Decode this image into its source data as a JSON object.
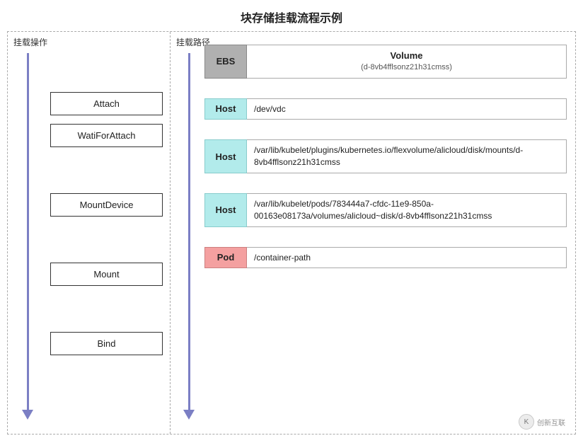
{
  "title": "块存储挂载流程示例",
  "left_header": "挂载操作",
  "right_header": "挂载路径",
  "operations": [
    {
      "id": "attach",
      "label": "Attach",
      "class": "op-attach"
    },
    {
      "id": "waitforattach",
      "label": "WatiForAttach",
      "class": "op-waitfor"
    },
    {
      "id": "mountdevice",
      "label": "MountDevice",
      "class": "op-mountdevice"
    },
    {
      "id": "mount",
      "label": "Mount",
      "class": "op-mount"
    },
    {
      "id": "bind",
      "label": "Bind",
      "class": "op-bind"
    }
  ],
  "paths": [
    {
      "id": "ebs-volume",
      "label_type": "ebs",
      "label": "EBS",
      "value_title": "Volume",
      "value_sub": "(d-8vb4fflsonz21h31cmss)",
      "type": "ebs"
    },
    {
      "id": "host-dev",
      "label_type": "host",
      "label": "Host",
      "value": "/dev/vdc",
      "type": "host-simple"
    },
    {
      "id": "host-kubelet",
      "label_type": "host",
      "label": "Host",
      "value": "/var/lib/kubelet/plugins/kubernetes.io/flexvolume/alicloud/disk/mounts/d-8vb4fflsonz21h31cmss",
      "type": "host"
    },
    {
      "id": "host-pods",
      "label_type": "host",
      "label": "Host",
      "value": "/var/lib/kubelet/pods/783444a7-cfdc-11e9-850a-00163e08173a/volumes/alicloud~disk/d-8vb4fflsonz21h31cmss",
      "type": "host"
    },
    {
      "id": "pod-container",
      "label_type": "pod",
      "label": "Pod",
      "value": "/container-path",
      "type": "pod"
    }
  ],
  "watermark": {
    "circle_text": "K",
    "text": "创新互联"
  }
}
